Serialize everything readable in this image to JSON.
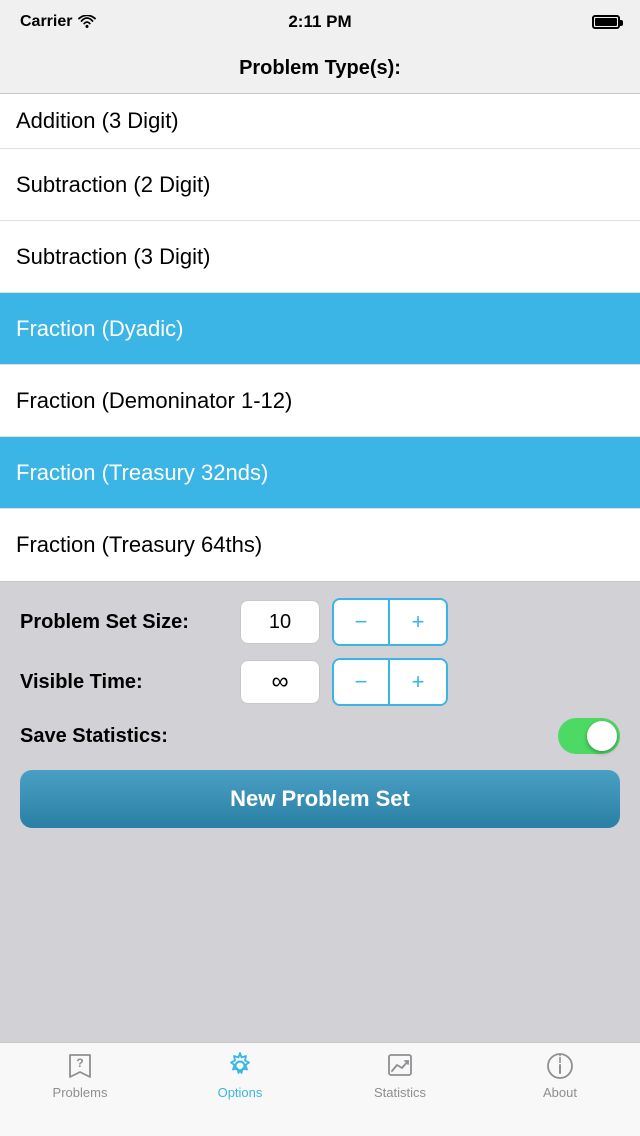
{
  "statusBar": {
    "carrier": "Carrier",
    "time": "2:11 PM"
  },
  "header": {
    "title": "Problem Type(s):"
  },
  "listItems": [
    {
      "id": "addition-3digit",
      "label": "Addition (3 Digit)",
      "selected": false,
      "partialTop": true
    },
    {
      "id": "subtraction-2digit",
      "label": "Subtraction (2 Digit)",
      "selected": false,
      "partialTop": false
    },
    {
      "id": "subtraction-3digit",
      "label": "Subtraction (3 Digit)",
      "selected": false,
      "partialTop": false
    },
    {
      "id": "fraction-dyadic",
      "label": "Fraction (Dyadic)",
      "selected": true,
      "partialTop": false
    },
    {
      "id": "fraction-denominator",
      "label": "Fraction (Demoninator 1-12)",
      "selected": false,
      "partialTop": false
    },
    {
      "id": "fraction-treasury-32nds",
      "label": "Fraction (Treasury 32nds)",
      "selected": true,
      "partialTop": false
    },
    {
      "id": "fraction-treasury-64ths",
      "label": "Fraction (Treasury 64ths)",
      "selected": false,
      "partialTop": false
    }
  ],
  "controls": {
    "problemSetSize": {
      "label": "Problem Set Size:",
      "value": "10"
    },
    "visibleTime": {
      "label": "Visible Time:",
      "value": "∞"
    },
    "saveStatistics": {
      "label": "Save Statistics:",
      "enabled": true
    }
  },
  "newProblemButton": {
    "label": "New Problem Set"
  },
  "tabBar": {
    "items": [
      {
        "id": "problems",
        "label": "Problems",
        "active": false,
        "icon": "question-bookmark-icon"
      },
      {
        "id": "options",
        "label": "Options",
        "active": true,
        "icon": "gear-icon"
      },
      {
        "id": "statistics",
        "label": "Statistics",
        "active": false,
        "icon": "chart-icon"
      },
      {
        "id": "about",
        "label": "About",
        "active": false,
        "icon": "info-icon"
      }
    ]
  }
}
